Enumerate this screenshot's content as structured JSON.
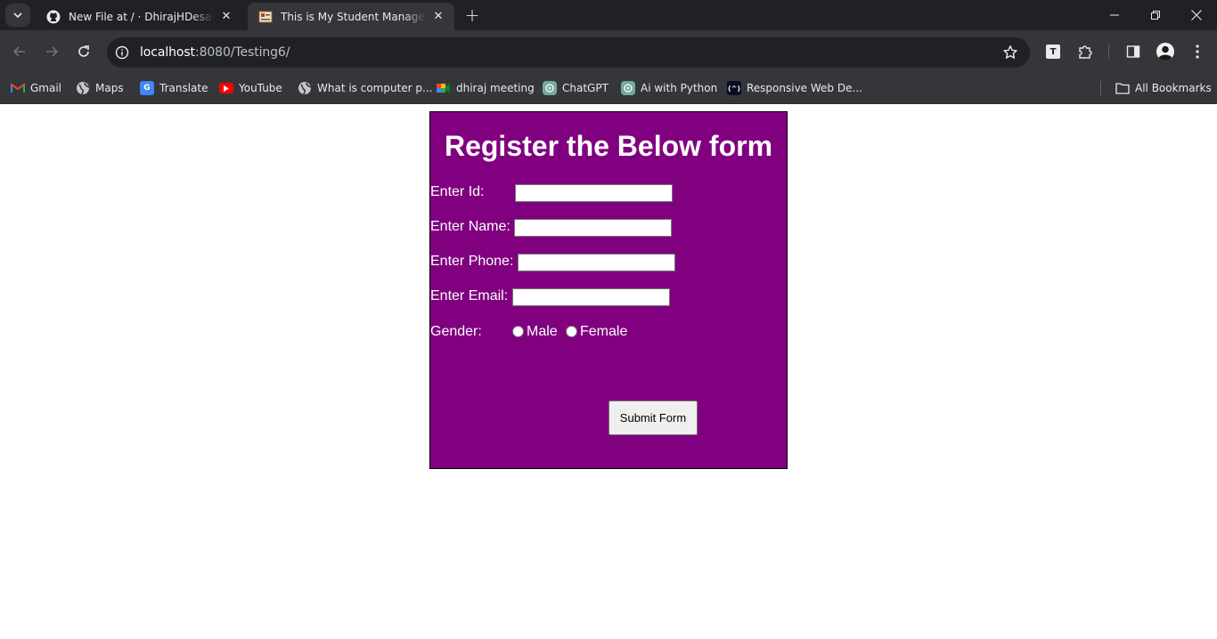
{
  "browser": {
    "tabs": [
      {
        "title": "New File at / · DhirajHDesale/Student-Management",
        "favicon": "github-icon",
        "active": false
      },
      {
        "title": "This is My Student Management",
        "favicon": "page-favicon-icon",
        "active": true
      }
    ],
    "url_host": "localhost",
    "url_path": ":8080/Testing6/",
    "bookmarks": [
      {
        "label": "Gmail",
        "icon": "gmail-icon"
      },
      {
        "label": "Maps",
        "icon": "maps-icon"
      },
      {
        "label": "Translate",
        "icon": "translate-icon"
      },
      {
        "label": "YouTube",
        "icon": "youtube-icon"
      },
      {
        "label": "What is computer p...",
        "icon": "globe-icon"
      },
      {
        "label": "dhiraj meeting",
        "icon": "meet-icon"
      },
      {
        "label": "ChatGPT",
        "icon": "chatgpt-icon"
      },
      {
        "label": "Ai with Python",
        "icon": "chatgpt-icon"
      },
      {
        "label": "Responsive Web De...",
        "icon": "freecodecamp-icon"
      }
    ],
    "all_bookmarks_label": "All Bookmarks",
    "extension_badge": "T",
    "colors": {
      "chrome_dark": "#202124",
      "chrome_mid": "#35363a"
    }
  },
  "form": {
    "title": "Register the Below form",
    "id_label": "Enter Id:",
    "id_value": "",
    "name_label": "Enter Name:",
    "name_value": "",
    "phone_label": "Enter Phone:",
    "phone_value": "",
    "email_label": "Enter Email:",
    "email_value": "",
    "gender_label": "Gender:",
    "gender_options": [
      "Male",
      "Female"
    ],
    "submit_label": "Submit Form",
    "colors": {
      "background": "#800080",
      "text": "#ffffff"
    }
  }
}
